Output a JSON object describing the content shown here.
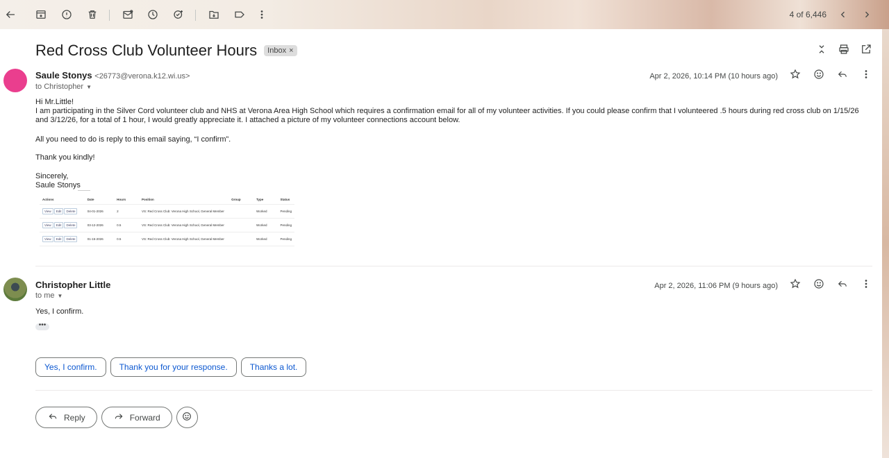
{
  "toolbar": {
    "counter": "4 of 6,446"
  },
  "email": {
    "subject": "Red Cross Club Volunteer Hours",
    "label": "Inbox",
    "label_remove": "×"
  },
  "message1": {
    "sender_name": "Saule Stonys",
    "sender_email": "<26773@verona.k12.wi.us>",
    "to": "to Christopher",
    "date": "Apr 2, 2026, 10:14 PM (10 hours ago)",
    "greeting": "Hi Mr.Little!",
    "para1_line1": "I am participating in the Silver Cord volunteer club and NHS at Verona Area High School which requires a confirmation email for all of my volunteer activities. If you could please confirm that I volunteered .5 hours during red cross club on 1/15/26",
    "para1_line2": "and 3/12/26, for a total of 1 hour, I would greatly appreciate it. I attached a picture of my volunteer connections account below.",
    "para2": "All you need to do is reply to this email saying, “I confirm”.",
    "para3": "Thank you kindly!",
    "closing": "Sincerely,",
    "signature": "Saule Stonys",
    "table": {
      "headers": [
        "Actions",
        "Date",
        "Hours",
        "Position",
        "Group",
        "Type",
        "Status"
      ],
      "action_labels": [
        "View",
        "Edit",
        "Delete"
      ],
      "rows": [
        {
          "date": "04-01-2026",
          "hours": "2",
          "position": "VS: Red Cross Club: Verona High School, General Member",
          "group": "",
          "type": "Worked",
          "status": "Pending"
        },
        {
          "date": "03-12-2026",
          "hours": "0.5",
          "position": "VS: Red Cross Club: Verona High School, General Member",
          "group": "",
          "type": "Worked",
          "status": "Pending"
        },
        {
          "date": "01-15-2026",
          "hours": "0.5",
          "position": "VS: Red Cross Club: Verona High School, General Member",
          "group": "",
          "type": "Worked",
          "status": "Pending"
        }
      ]
    }
  },
  "message2": {
    "sender_name": "Christopher Little",
    "to": "to me",
    "date": "Apr 2, 2026, 11:06 PM (9 hours ago)",
    "body": "Yes, I confirm.",
    "dots": "•••"
  },
  "smart_replies": [
    "Yes, I confirm.",
    "Thank you for your response.",
    "Thanks a lot."
  ],
  "actions": {
    "reply": "Reply",
    "forward": "Forward"
  }
}
